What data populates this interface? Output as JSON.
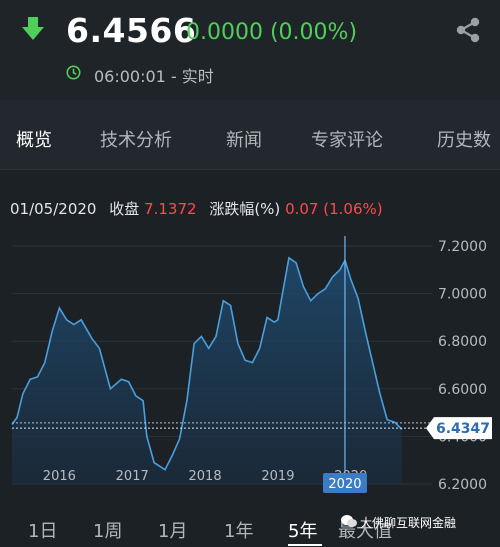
{
  "header": {
    "price": "6.4566",
    "change": "0.0000 (0.00%)",
    "time": "06:00:01 - 实时",
    "colors": {
      "up": "#4fcf5a",
      "down": "#ff4a48"
    },
    "icons": [
      "arrow-down-icon",
      "share-icon",
      "clock-icon"
    ]
  },
  "tabs": [
    {
      "label": "概览",
      "active": true
    },
    {
      "label": "技术分析"
    },
    {
      "label": "新闻"
    },
    {
      "label": "专家评论"
    },
    {
      "label": "历史数"
    }
  ],
  "info": {
    "date": "01/05/2020",
    "close_label": "收盘",
    "close_value": "7.1372",
    "change_label": "涨跌幅(%)",
    "change_value": "0.07 (1.06%)"
  },
  "chart_data": {
    "type": "area",
    "y_ticks": [
      "7.2000",
      "7.0000",
      "6.8000",
      "6.6000",
      "6.4000",
      "6.2000"
    ],
    "ylim": [
      6.2,
      7.2
    ],
    "x_ticks": [
      {
        "label": "2016",
        "x": 2016.0
      },
      {
        "label": "2017",
        "x": 2017.0
      },
      {
        "label": "2018",
        "x": 2018.0
      },
      {
        "label": "2019",
        "x": 2019.0
      },
      {
        "label": "2020",
        "x": 2020.0
      }
    ],
    "xlim": [
      2015.35,
      2020.95
    ],
    "current_value": "6.4347",
    "current": 6.4347,
    "reference": 6.4566,
    "crosshair": {
      "x": 2019.92,
      "label": "2020"
    },
    "series_color": "#4a9fdc",
    "x": [
      2015.35,
      2015.42,
      2015.5,
      2015.6,
      2015.7,
      2015.8,
      2015.9,
      2016.0,
      2016.1,
      2016.2,
      2016.3,
      2016.45,
      2016.55,
      2016.7,
      2016.85,
      2016.95,
      2017.05,
      2017.15,
      2017.2,
      2017.3,
      2017.45,
      2017.55,
      2017.65,
      2017.75,
      2017.85,
      2017.95,
      2018.05,
      2018.15,
      2018.25,
      2018.35,
      2018.45,
      2018.55,
      2018.65,
      2018.75,
      2018.85,
      2018.95,
      2019.0,
      2019.05,
      2019.15,
      2019.25,
      2019.35,
      2019.45,
      2019.55,
      2019.65,
      2019.75,
      2019.85,
      2019.92,
      2020.0,
      2020.1,
      2020.2,
      2020.3,
      2020.4,
      2020.5,
      2020.6,
      2020.7
    ],
    "values": [
      6.45,
      6.48,
      6.58,
      6.64,
      6.65,
      6.71,
      6.84,
      6.94,
      6.89,
      6.87,
      6.89,
      6.81,
      6.77,
      6.6,
      6.64,
      6.63,
      6.57,
      6.55,
      6.4,
      6.29,
      6.26,
      6.32,
      6.39,
      6.55,
      6.79,
      6.82,
      6.77,
      6.82,
      6.97,
      6.95,
      6.79,
      6.72,
      6.71,
      6.77,
      6.9,
      6.88,
      6.89,
      6.98,
      7.15,
      7.13,
      7.03,
      6.97,
      7.0,
      7.02,
      7.07,
      7.1,
      7.14,
      7.06,
      6.98,
      6.84,
      6.71,
      6.58,
      6.47,
      6.46,
      6.43
    ]
  },
  "periods": [
    {
      "label": "1日"
    },
    {
      "label": "1周"
    },
    {
      "label": "1月"
    },
    {
      "label": "1年"
    },
    {
      "label": "5年",
      "active": true
    },
    {
      "label": "最大值"
    }
  ],
  "watermark": "大佛聊互联网金融"
}
